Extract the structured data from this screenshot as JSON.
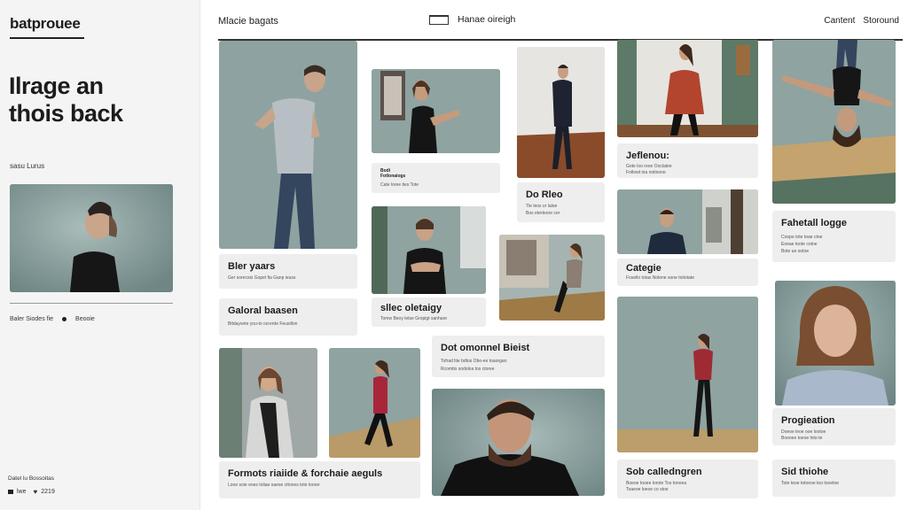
{
  "sidebar": {
    "brand": "batprouee",
    "hero_line1": "Ilrage an",
    "hero_line2": "thois back",
    "section_label": "sasu Lurus",
    "meta_left": "Baler Siodes fie",
    "meta_right": "Beooie",
    "footer_note": "Datel lu Bossoitas",
    "footer_left": "lwe",
    "footer_count": "2219"
  },
  "topbar": {
    "nav_left": "Mlacie bagats",
    "toggle_label": "Hanae oireigh",
    "content_link": "Cantent",
    "background_link": "Storound"
  },
  "cards": {
    "c1": {
      "title": "Bler yaars",
      "sub": "Ger sorecsio Gopel fia Ganp ieuss"
    },
    "c2": {
      "title": "Galoral baasen",
      "sub": "Bitdayvete you-to ocrerde Feusillon"
    },
    "c3": {
      "title": "Bodi",
      "sub": "Fotlonaiogs",
      "sub2": "Cate loree ties Tote"
    },
    "c4": {
      "title": "sllec oletaigy",
      "sub": "Tomw Beoy letse Gropigt sanhare"
    },
    "c5": {
      "title": "Do Rleo",
      "sub": "Tle leos or laloe",
      "sub2": "Bos eterteore cer"
    },
    "c6": {
      "title": "Dot omonnel Bieist",
      "sub": "Tofrad ltie bdtos Obo-ee toaorgan",
      "sub2": "Rcomtio sodoloa tos ctoree"
    },
    "c7": {
      "title": "Jeflenou:",
      "sub": "Gote loo reoe Ooclatee",
      "sub2": "Fotlowt nia notioone"
    },
    "c8": {
      "title": "Categie",
      "sub": "Fosello totas Nolene sone totiotate"
    },
    "c9": {
      "title": "Fahetall logge",
      "sub": "Coope tote toae ctoe",
      "sub2": "Eoeae toote cotoe",
      "sub3": "Bote ue ootoe"
    },
    "c10": {
      "title": "Formots riaiide & forchaie aeguls",
      "sub": "Looe soie eoes toliae oaese cttonos tote loroer"
    },
    "c11": {
      "title": "Sob calledngren",
      "sub": "Boeoe tooee lorote Tos tonoea",
      "sub2": "Toaeoe loeoe co stoe"
    },
    "c12": {
      "title": "Progieation",
      "sub": "Doeoe leoe ooe lootoe",
      "sub2": "Boeoee toeoe lnto-te"
    },
    "c13": {
      "title": "Sid thiohe",
      "sub": "Tote teoe totoeoe too tooetoe"
    }
  },
  "colors": {
    "sidebar_bg": "#f4f4f4",
    "card_bg": "#eeeeee",
    "backdrop_teal": "#8fa3a1",
    "text": "#1c1c1c"
  },
  "icons": [
    "toggle-icon",
    "heart-icon",
    "user-icon"
  ]
}
